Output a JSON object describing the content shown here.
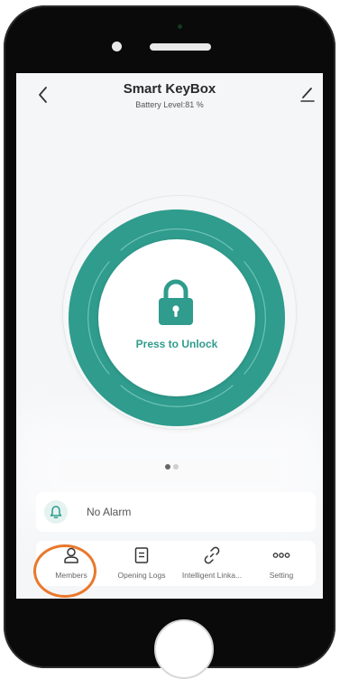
{
  "header": {
    "title": "Smart KeyBox",
    "subtitle": "Battery Level:81 %"
  },
  "lock": {
    "label": "Press to Unlock",
    "battery_percent": 81
  },
  "pager": {
    "page_count": 2,
    "active_index": 0
  },
  "alarm": {
    "label": "No Alarm"
  },
  "tabs": [
    {
      "label": "Members",
      "icon": "person-icon"
    },
    {
      "label": "Opening Logs",
      "icon": "document-icon"
    },
    {
      "label": "Intelligent Linka...",
      "icon": "link-icon"
    },
    {
      "label": "Setting",
      "icon": "more-dots-icon"
    }
  ],
  "colors": {
    "accent": "#2f9c8d",
    "highlight_circle": "#e9782b",
    "phone_frame": "#0a0a0a",
    "screen_background": "#f5f6f8"
  }
}
